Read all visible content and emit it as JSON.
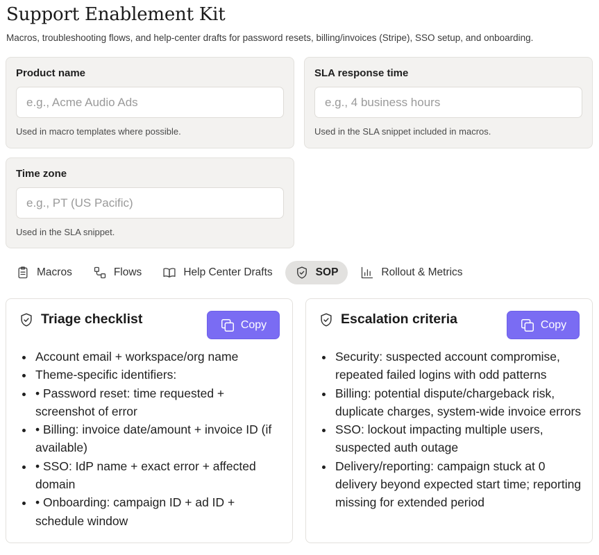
{
  "page": {
    "title": "Support Enablement Kit",
    "subtitle": "Macros, troubleshooting flows, and help-center drafts for password resets, billing/invoices (Stripe), SSO setup, and onboarding."
  },
  "fields": {
    "product_name": {
      "label": "Product name",
      "placeholder": "e.g., Acme Audio Ads",
      "help": "Used in macro templates where possible."
    },
    "sla_response_time": {
      "label": "SLA response time",
      "placeholder": "e.g., 4 business hours",
      "help": "Used in the SLA snippet included in macros."
    },
    "time_zone": {
      "label": "Time zone",
      "placeholder": "e.g., PT (US Pacific)",
      "help": "Used in the SLA snippet."
    }
  },
  "tabs": [
    {
      "label": "Macros",
      "icon": "clipboard-icon"
    },
    {
      "label": "Flows",
      "icon": "flow-icon"
    },
    {
      "label": "Help Center Drafts",
      "icon": "book-icon"
    },
    {
      "label": "SOP",
      "icon": "shield-icon",
      "active": true
    },
    {
      "label": "Rollout & Metrics",
      "icon": "bar-chart-icon"
    }
  ],
  "cards": {
    "triage": {
      "title": "Triage checklist",
      "copy_label": "Copy",
      "items": [
        "Account email + workspace/org name",
        "Theme-specific identifiers:",
        "• Password reset: time requested + screenshot of error",
        "• Billing: invoice date/amount + invoice ID (if available)",
        "• SSO: IdP name + exact error + affected domain",
        "• Onboarding: campaign ID + ad ID + schedule window"
      ]
    },
    "escalation": {
      "title": "Escalation criteria",
      "copy_label": "Copy",
      "items": [
        "Security: suspected account compromise, repeated failed logins with odd patterns",
        "Billing: potential dispute/chargeback risk, duplicate charges, system-wide invoice errors",
        "SSO: lockout impacting multiple users, suspected auth outage",
        "Delivery/reporting: campaign stuck at 0 delivery beyond expected start time; reporting missing for extended period"
      ]
    }
  },
  "colors": {
    "accent": "#7a6cf3",
    "card_bg": "#f3f2f0",
    "active_tab_bg": "#e2e1df"
  }
}
